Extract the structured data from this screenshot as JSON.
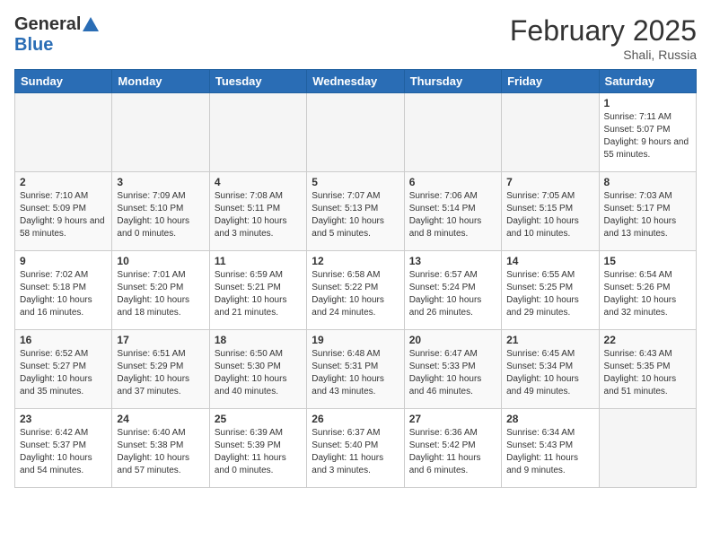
{
  "header": {
    "logo_general": "General",
    "logo_blue": "Blue",
    "month_title": "February 2025",
    "location": "Shali, Russia"
  },
  "weekdays": [
    "Sunday",
    "Monday",
    "Tuesday",
    "Wednesday",
    "Thursday",
    "Friday",
    "Saturday"
  ],
  "weeks": [
    {
      "days": [
        {
          "num": "",
          "info": ""
        },
        {
          "num": "",
          "info": ""
        },
        {
          "num": "",
          "info": ""
        },
        {
          "num": "",
          "info": ""
        },
        {
          "num": "",
          "info": ""
        },
        {
          "num": "",
          "info": ""
        },
        {
          "num": "1",
          "info": "Sunrise: 7:11 AM\nSunset: 5:07 PM\nDaylight: 9 hours and 55 minutes."
        }
      ]
    },
    {
      "days": [
        {
          "num": "2",
          "info": "Sunrise: 7:10 AM\nSunset: 5:09 PM\nDaylight: 9 hours and 58 minutes."
        },
        {
          "num": "3",
          "info": "Sunrise: 7:09 AM\nSunset: 5:10 PM\nDaylight: 10 hours and 0 minutes."
        },
        {
          "num": "4",
          "info": "Sunrise: 7:08 AM\nSunset: 5:11 PM\nDaylight: 10 hours and 3 minutes."
        },
        {
          "num": "5",
          "info": "Sunrise: 7:07 AM\nSunset: 5:13 PM\nDaylight: 10 hours and 5 minutes."
        },
        {
          "num": "6",
          "info": "Sunrise: 7:06 AM\nSunset: 5:14 PM\nDaylight: 10 hours and 8 minutes."
        },
        {
          "num": "7",
          "info": "Sunrise: 7:05 AM\nSunset: 5:15 PM\nDaylight: 10 hours and 10 minutes."
        },
        {
          "num": "8",
          "info": "Sunrise: 7:03 AM\nSunset: 5:17 PM\nDaylight: 10 hours and 13 minutes."
        }
      ]
    },
    {
      "days": [
        {
          "num": "9",
          "info": "Sunrise: 7:02 AM\nSunset: 5:18 PM\nDaylight: 10 hours and 16 minutes."
        },
        {
          "num": "10",
          "info": "Sunrise: 7:01 AM\nSunset: 5:20 PM\nDaylight: 10 hours and 18 minutes."
        },
        {
          "num": "11",
          "info": "Sunrise: 6:59 AM\nSunset: 5:21 PM\nDaylight: 10 hours and 21 minutes."
        },
        {
          "num": "12",
          "info": "Sunrise: 6:58 AM\nSunset: 5:22 PM\nDaylight: 10 hours and 24 minutes."
        },
        {
          "num": "13",
          "info": "Sunrise: 6:57 AM\nSunset: 5:24 PM\nDaylight: 10 hours and 26 minutes."
        },
        {
          "num": "14",
          "info": "Sunrise: 6:55 AM\nSunset: 5:25 PM\nDaylight: 10 hours and 29 minutes."
        },
        {
          "num": "15",
          "info": "Sunrise: 6:54 AM\nSunset: 5:26 PM\nDaylight: 10 hours and 32 minutes."
        }
      ]
    },
    {
      "days": [
        {
          "num": "16",
          "info": "Sunrise: 6:52 AM\nSunset: 5:27 PM\nDaylight: 10 hours and 35 minutes."
        },
        {
          "num": "17",
          "info": "Sunrise: 6:51 AM\nSunset: 5:29 PM\nDaylight: 10 hours and 37 minutes."
        },
        {
          "num": "18",
          "info": "Sunrise: 6:50 AM\nSunset: 5:30 PM\nDaylight: 10 hours and 40 minutes."
        },
        {
          "num": "19",
          "info": "Sunrise: 6:48 AM\nSunset: 5:31 PM\nDaylight: 10 hours and 43 minutes."
        },
        {
          "num": "20",
          "info": "Sunrise: 6:47 AM\nSunset: 5:33 PM\nDaylight: 10 hours and 46 minutes."
        },
        {
          "num": "21",
          "info": "Sunrise: 6:45 AM\nSunset: 5:34 PM\nDaylight: 10 hours and 49 minutes."
        },
        {
          "num": "22",
          "info": "Sunrise: 6:43 AM\nSunset: 5:35 PM\nDaylight: 10 hours and 51 minutes."
        }
      ]
    },
    {
      "days": [
        {
          "num": "23",
          "info": "Sunrise: 6:42 AM\nSunset: 5:37 PM\nDaylight: 10 hours and 54 minutes."
        },
        {
          "num": "24",
          "info": "Sunrise: 6:40 AM\nSunset: 5:38 PM\nDaylight: 10 hours and 57 minutes."
        },
        {
          "num": "25",
          "info": "Sunrise: 6:39 AM\nSunset: 5:39 PM\nDaylight: 11 hours and 0 minutes."
        },
        {
          "num": "26",
          "info": "Sunrise: 6:37 AM\nSunset: 5:40 PM\nDaylight: 11 hours and 3 minutes."
        },
        {
          "num": "27",
          "info": "Sunrise: 6:36 AM\nSunset: 5:42 PM\nDaylight: 11 hours and 6 minutes."
        },
        {
          "num": "28",
          "info": "Sunrise: 6:34 AM\nSunset: 5:43 PM\nDaylight: 11 hours and 9 minutes."
        },
        {
          "num": "",
          "info": ""
        }
      ]
    }
  ]
}
